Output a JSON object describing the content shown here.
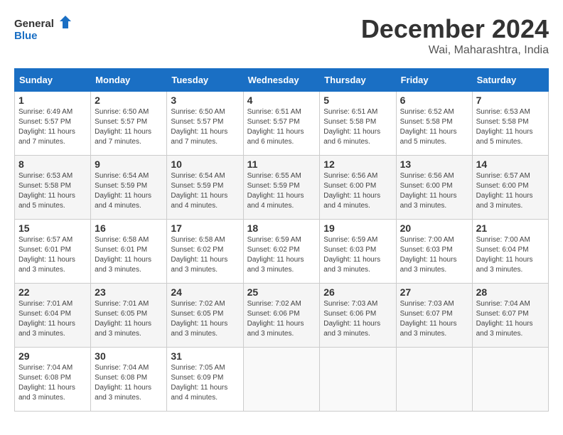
{
  "logo": {
    "text_general": "General",
    "text_blue": "Blue"
  },
  "header": {
    "month": "December 2024",
    "location": "Wai, Maharashtra, India"
  },
  "weekdays": [
    "Sunday",
    "Monday",
    "Tuesday",
    "Wednesday",
    "Thursday",
    "Friday",
    "Saturday"
  ],
  "weeks": [
    [
      {
        "day": "1",
        "sunrise": "6:49 AM",
        "sunset": "5:57 PM",
        "daylight": "11 hours and 7 minutes."
      },
      {
        "day": "2",
        "sunrise": "6:50 AM",
        "sunset": "5:57 PM",
        "daylight": "11 hours and 7 minutes."
      },
      {
        "day": "3",
        "sunrise": "6:50 AM",
        "sunset": "5:57 PM",
        "daylight": "11 hours and 7 minutes."
      },
      {
        "day": "4",
        "sunrise": "6:51 AM",
        "sunset": "5:57 PM",
        "daylight": "11 hours and 6 minutes."
      },
      {
        "day": "5",
        "sunrise": "6:51 AM",
        "sunset": "5:58 PM",
        "daylight": "11 hours and 6 minutes."
      },
      {
        "day": "6",
        "sunrise": "6:52 AM",
        "sunset": "5:58 PM",
        "daylight": "11 hours and 5 minutes."
      },
      {
        "day": "7",
        "sunrise": "6:53 AM",
        "sunset": "5:58 PM",
        "daylight": "11 hours and 5 minutes."
      }
    ],
    [
      {
        "day": "8",
        "sunrise": "6:53 AM",
        "sunset": "5:58 PM",
        "daylight": "11 hours and 5 minutes."
      },
      {
        "day": "9",
        "sunrise": "6:54 AM",
        "sunset": "5:59 PM",
        "daylight": "11 hours and 4 minutes."
      },
      {
        "day": "10",
        "sunrise": "6:54 AM",
        "sunset": "5:59 PM",
        "daylight": "11 hours and 4 minutes."
      },
      {
        "day": "11",
        "sunrise": "6:55 AM",
        "sunset": "5:59 PM",
        "daylight": "11 hours and 4 minutes."
      },
      {
        "day": "12",
        "sunrise": "6:56 AM",
        "sunset": "6:00 PM",
        "daylight": "11 hours and 4 minutes."
      },
      {
        "day": "13",
        "sunrise": "6:56 AM",
        "sunset": "6:00 PM",
        "daylight": "11 hours and 3 minutes."
      },
      {
        "day": "14",
        "sunrise": "6:57 AM",
        "sunset": "6:00 PM",
        "daylight": "11 hours and 3 minutes."
      }
    ],
    [
      {
        "day": "15",
        "sunrise": "6:57 AM",
        "sunset": "6:01 PM",
        "daylight": "11 hours and 3 minutes."
      },
      {
        "day": "16",
        "sunrise": "6:58 AM",
        "sunset": "6:01 PM",
        "daylight": "11 hours and 3 minutes."
      },
      {
        "day": "17",
        "sunrise": "6:58 AM",
        "sunset": "6:02 PM",
        "daylight": "11 hours and 3 minutes."
      },
      {
        "day": "18",
        "sunrise": "6:59 AM",
        "sunset": "6:02 PM",
        "daylight": "11 hours and 3 minutes."
      },
      {
        "day": "19",
        "sunrise": "6:59 AM",
        "sunset": "6:03 PM",
        "daylight": "11 hours and 3 minutes."
      },
      {
        "day": "20",
        "sunrise": "7:00 AM",
        "sunset": "6:03 PM",
        "daylight": "11 hours and 3 minutes."
      },
      {
        "day": "21",
        "sunrise": "7:00 AM",
        "sunset": "6:04 PM",
        "daylight": "11 hours and 3 minutes."
      }
    ],
    [
      {
        "day": "22",
        "sunrise": "7:01 AM",
        "sunset": "6:04 PM",
        "daylight": "11 hours and 3 minutes."
      },
      {
        "day": "23",
        "sunrise": "7:01 AM",
        "sunset": "6:05 PM",
        "daylight": "11 hours and 3 minutes."
      },
      {
        "day": "24",
        "sunrise": "7:02 AM",
        "sunset": "6:05 PM",
        "daylight": "11 hours and 3 minutes."
      },
      {
        "day": "25",
        "sunrise": "7:02 AM",
        "sunset": "6:06 PM",
        "daylight": "11 hours and 3 minutes."
      },
      {
        "day": "26",
        "sunrise": "7:03 AM",
        "sunset": "6:06 PM",
        "daylight": "11 hours and 3 minutes."
      },
      {
        "day": "27",
        "sunrise": "7:03 AM",
        "sunset": "6:07 PM",
        "daylight": "11 hours and 3 minutes."
      },
      {
        "day": "28",
        "sunrise": "7:04 AM",
        "sunset": "6:07 PM",
        "daylight": "11 hours and 3 minutes."
      }
    ],
    [
      {
        "day": "29",
        "sunrise": "7:04 AM",
        "sunset": "6:08 PM",
        "daylight": "11 hours and 3 minutes."
      },
      {
        "day": "30",
        "sunrise": "7:04 AM",
        "sunset": "6:08 PM",
        "daylight": "11 hours and 3 minutes."
      },
      {
        "day": "31",
        "sunrise": "7:05 AM",
        "sunset": "6:09 PM",
        "daylight": "11 hours and 4 minutes."
      },
      null,
      null,
      null,
      null
    ]
  ],
  "labels": {
    "sunrise": "Sunrise:",
    "sunset": "Sunset:",
    "daylight": "Daylight:"
  }
}
